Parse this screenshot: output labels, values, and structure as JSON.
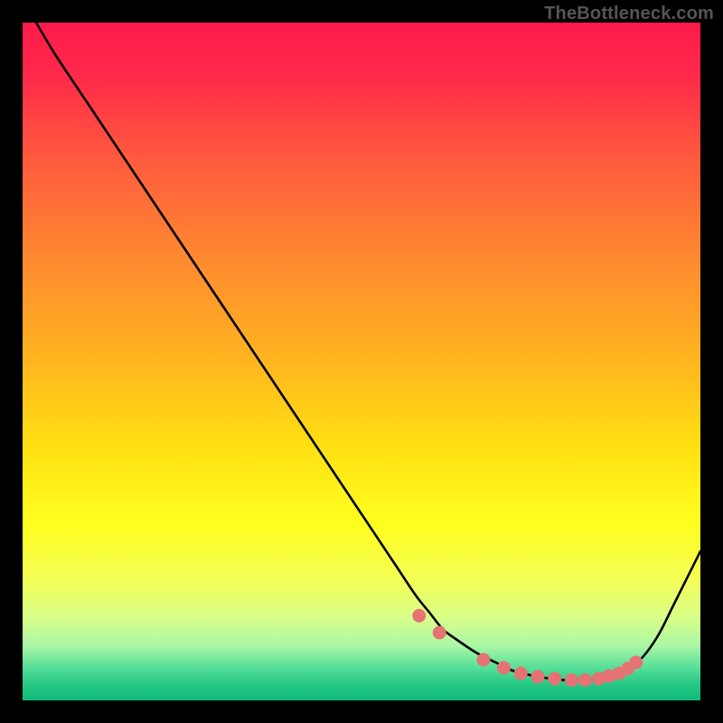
{
  "watermark": "TheBottleneck.com",
  "colors": {
    "gradient_stops": [
      {
        "offset": 0.0,
        "color": "#ff1a4b"
      },
      {
        "offset": 0.08,
        "color": "#ff2a4a"
      },
      {
        "offset": 0.2,
        "color": "#ff5a3e"
      },
      {
        "offset": 0.35,
        "color": "#ff8a30"
      },
      {
        "offset": 0.5,
        "color": "#ffb51f"
      },
      {
        "offset": 0.62,
        "color": "#ffde12"
      },
      {
        "offset": 0.74,
        "color": "#ffff1e"
      },
      {
        "offset": 0.82,
        "color": "#f4ff55"
      },
      {
        "offset": 0.88,
        "color": "#d7ff8a"
      },
      {
        "offset": 0.92,
        "color": "#a9f7a6"
      },
      {
        "offset": 0.95,
        "color": "#5be09a"
      },
      {
        "offset": 0.975,
        "color": "#27c985"
      },
      {
        "offset": 1.0,
        "color": "#0fb977"
      }
    ],
    "curve": "#000000",
    "marker_fill": "#e57373",
    "marker_stroke": "#d46a6a",
    "frame": "#000000"
  },
  "chart_data": {
    "type": "line",
    "title": "",
    "xlabel": "",
    "ylabel": "",
    "xlim": [
      0,
      100
    ],
    "ylim": [
      0,
      100
    ],
    "grid": false,
    "legend": false,
    "series": [
      {
        "name": "curve",
        "x": [
          2,
          5,
          10,
          15,
          20,
          25,
          30,
          35,
          40,
          45,
          50,
          55,
          58,
          60,
          62,
          64,
          67,
          70,
          72,
          75,
          78,
          80,
          82,
          85,
          88,
          90,
          92,
          94,
          96,
          100
        ],
        "y": [
          100,
          95,
          87.5,
          80,
          72.5,
          65,
          57.5,
          50,
          42.5,
          35,
          27.5,
          20,
          15.5,
          13,
          10.5,
          9,
          7,
          5.5,
          4.5,
          3.7,
          3.2,
          3.0,
          3.0,
          3.2,
          3.9,
          5.0,
          7.0,
          10.0,
          14.0,
          22.0
        ]
      }
    ],
    "markers": {
      "name": "dots",
      "x": [
        58.5,
        61.5,
        68,
        71,
        73.5,
        76,
        78.5,
        81,
        83,
        85,
        86.5,
        88,
        89.3,
        90.5
      ],
      "y": [
        12.5,
        10.0,
        6.0,
        4.8,
        4.0,
        3.5,
        3.2,
        3.0,
        3.0,
        3.2,
        3.6,
        4.0,
        4.7,
        5.6
      ]
    }
  }
}
